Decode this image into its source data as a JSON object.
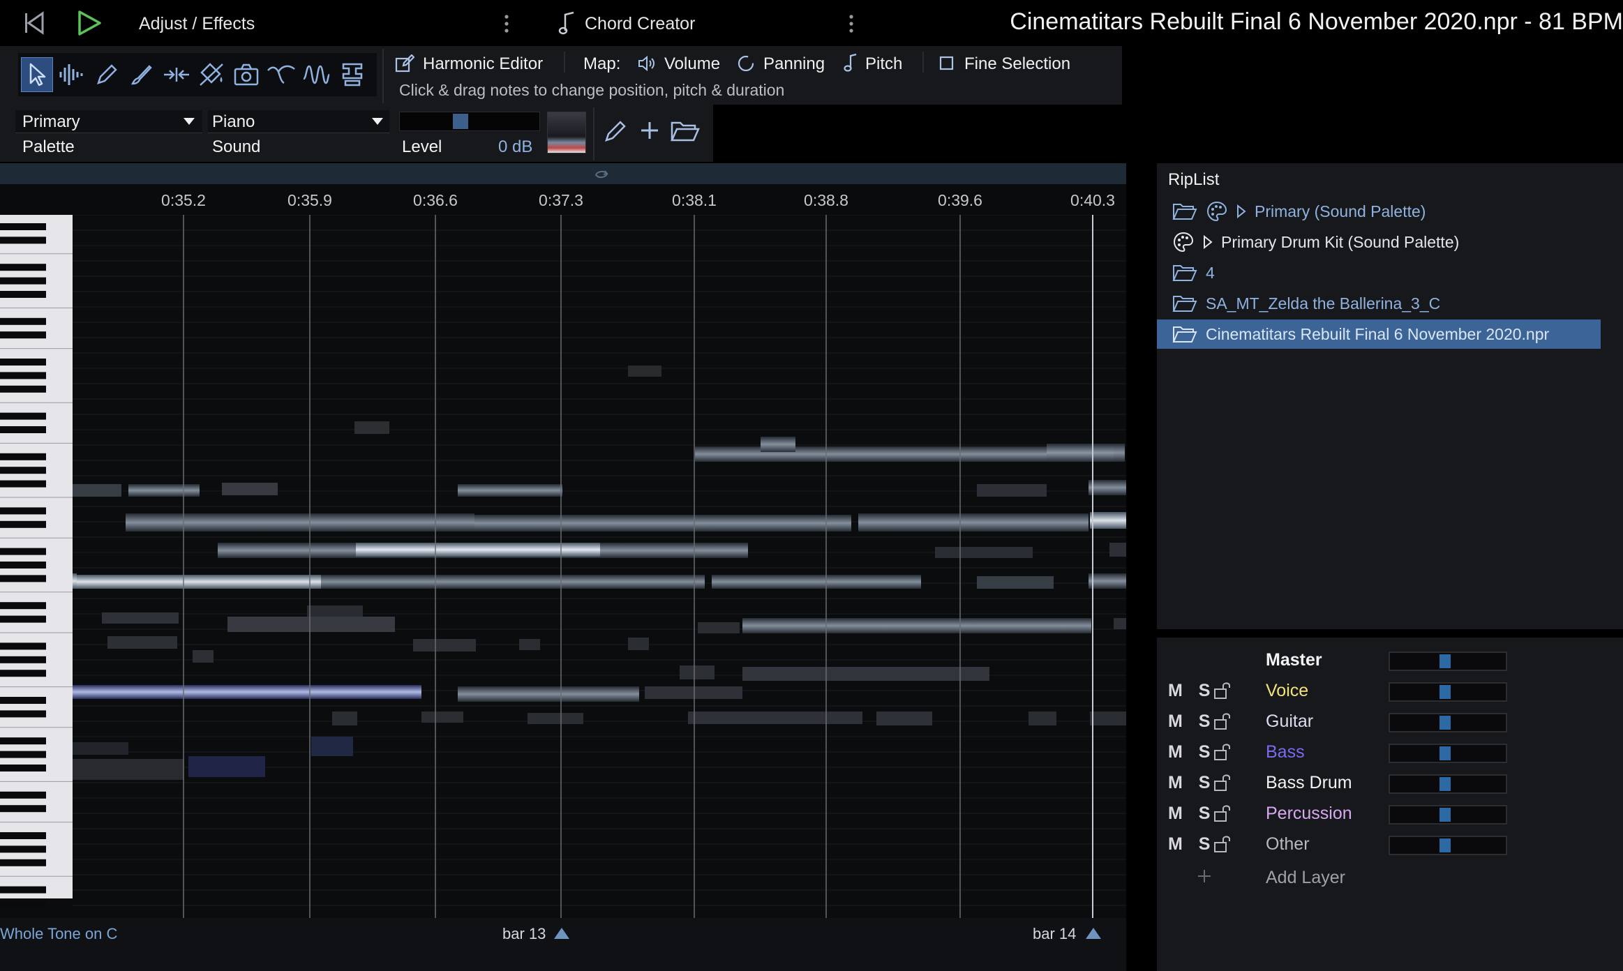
{
  "topbar": {
    "adjust_effects": "Adjust / Effects",
    "chord_creator": "Chord Creator",
    "title": "Cinematitars Rebuilt Final 6 November 2020.npr - 81 BPM"
  },
  "tools": {
    "harmonic_editor": "Harmonic Editor",
    "map_label": "Map:",
    "volume": "Volume",
    "panning": "Panning",
    "pitch": "Pitch",
    "fine_selection": "Fine Selection",
    "hint": "Click & drag notes to change position, pitch & duration"
  },
  "palette": {
    "palette_value": "Primary",
    "palette_label": "Palette",
    "sound_value": "Piano",
    "sound_label": "Sound",
    "level_label": "Level",
    "level_value": "0 dB",
    "level_fraction": 0.5
  },
  "timeline": {
    "ticks": [
      "0:35.2",
      "0:35.9",
      "0:36.6",
      "0:37.3",
      "0:38.1",
      "0:38.8",
      "0:39.6",
      "0:40.3"
    ]
  },
  "bottom": {
    "scale": "Whole Tone on C",
    "bar13": "bar 13",
    "bar14": "bar 14"
  },
  "riplist": {
    "title": "RipList",
    "items": [
      {
        "label": "Primary (Sound Palette)",
        "color": "#8fb2e0"
      },
      {
        "label": "Primary Drum Kit (Sound Palette)",
        "color": "#e6e6ea"
      },
      {
        "label": "4",
        "color": "#8fb2e0"
      },
      {
        "label": "SA_MT_Zelda the Ballerina_3_C",
        "color": "#8fb2e0"
      },
      {
        "label": "Cinematitars Rebuilt Final 6 November 2020.npr",
        "color": "#d9e6f5"
      }
    ],
    "selected_index": 4,
    "selected_color": "#3c6496"
  },
  "layers": {
    "ms_label": "M S",
    "master": {
      "name": "Master",
      "level": 0.5
    },
    "items": [
      {
        "name": "Voice",
        "color": "#f2e27a",
        "level": 0.5
      },
      {
        "name": "Guitar",
        "color": "#dcdcf0",
        "level": 0.5
      },
      {
        "name": "Bass",
        "color": "#7a6cf0",
        "level": 0.5
      },
      {
        "name": "Bass Drum",
        "color": "#f2f2f4",
        "level": 0.5
      },
      {
        "name": "Percussion",
        "color": "#d8a8f0",
        "level": 0.5
      },
      {
        "name": "Other",
        "color": "#b8b8c0",
        "level": 0.5
      }
    ],
    "add_layer": "Add Layer"
  }
}
